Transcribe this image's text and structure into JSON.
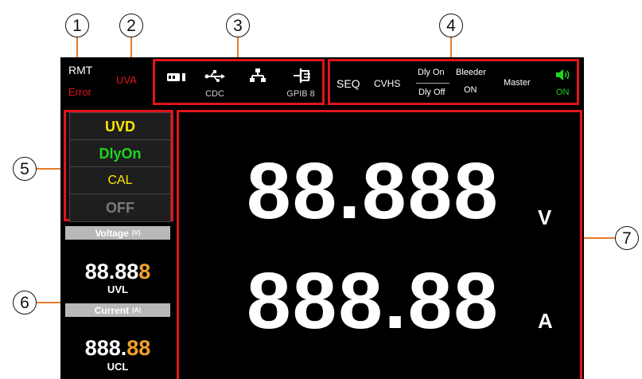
{
  "callouts": [
    "1",
    "2",
    "3",
    "4",
    "5",
    "6",
    "7"
  ],
  "status": {
    "rmt": "RMT",
    "error": "Error",
    "uva": "UVA"
  },
  "interfaces": {
    "icons": [
      "usb-host-icon",
      "usb-icon",
      "lan-icon",
      "gpib-icon"
    ],
    "cdc": "CDC",
    "gpib": "GPIB 8"
  },
  "settings": {
    "seq": "SEQ",
    "cvhs": "CVHS",
    "dly_on": "Dly On",
    "dly_off": "Dly Off",
    "bleeder": "Bleeder",
    "bleeder_state": "ON",
    "master": "Master",
    "sound_state": "ON"
  },
  "modes": [
    {
      "label": "UVD",
      "color": "#ffe600"
    },
    {
      "label": "DlyOn",
      "color": "#1ed61e"
    },
    {
      "label": "CAL",
      "color": "#ffe600"
    },
    {
      "label": "OFF",
      "color": "#7a7a7a"
    }
  ],
  "side_panel": {
    "voltage_header": "Voltage",
    "voltage_unit": "(V)",
    "voltage_main": "88.88",
    "voltage_highlight": "8",
    "voltage_limit": "UVL",
    "current_header": "Current",
    "current_unit": "(A)",
    "current_main": "888.",
    "current_highlight": "88",
    "current_limit": "UCL",
    "highlight_color": "#f0a02a"
  },
  "main_display": {
    "voltage": "88.888",
    "voltage_unit": "V",
    "current": "888.88",
    "current_unit": "A"
  },
  "colors": {
    "callout_line": "#e87a2a",
    "frame": "#e0151b",
    "error": "#e0151b",
    "sound": "#1ed61e"
  }
}
